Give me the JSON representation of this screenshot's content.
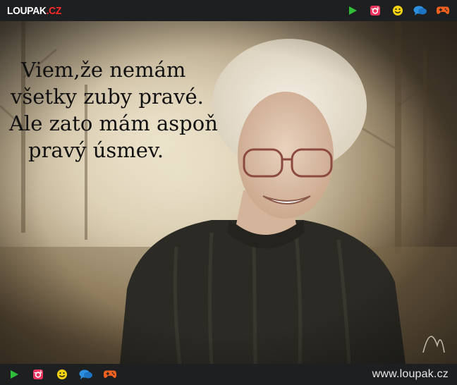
{
  "header": {
    "logo_main": "LOUPAK",
    "logo_tld": ".CZ",
    "icons": [
      "play-icon",
      "instagram-icon",
      "smiley-icon",
      "chat-icon",
      "gamepad-icon"
    ]
  },
  "quote": {
    "lines": [
      "Viem,že nemám",
      "všetky zuby pravé.",
      "Ale zato mám aspoň",
      "pravý úsmev."
    ]
  },
  "footer": {
    "icons": [
      "play-icon",
      "instagram-icon",
      "smiley-icon",
      "chat-icon",
      "gamepad-icon"
    ],
    "url": "www.loupak.cz"
  },
  "colors": {
    "bar_bg": "#1e1f21",
    "play": "#2fbf3a",
    "instagram": "#e7335e",
    "smiley": "#f5d311",
    "chat": "#2c8fe0",
    "gamepad": "#f2621e",
    "logo_tld": "#ff2b2b"
  }
}
